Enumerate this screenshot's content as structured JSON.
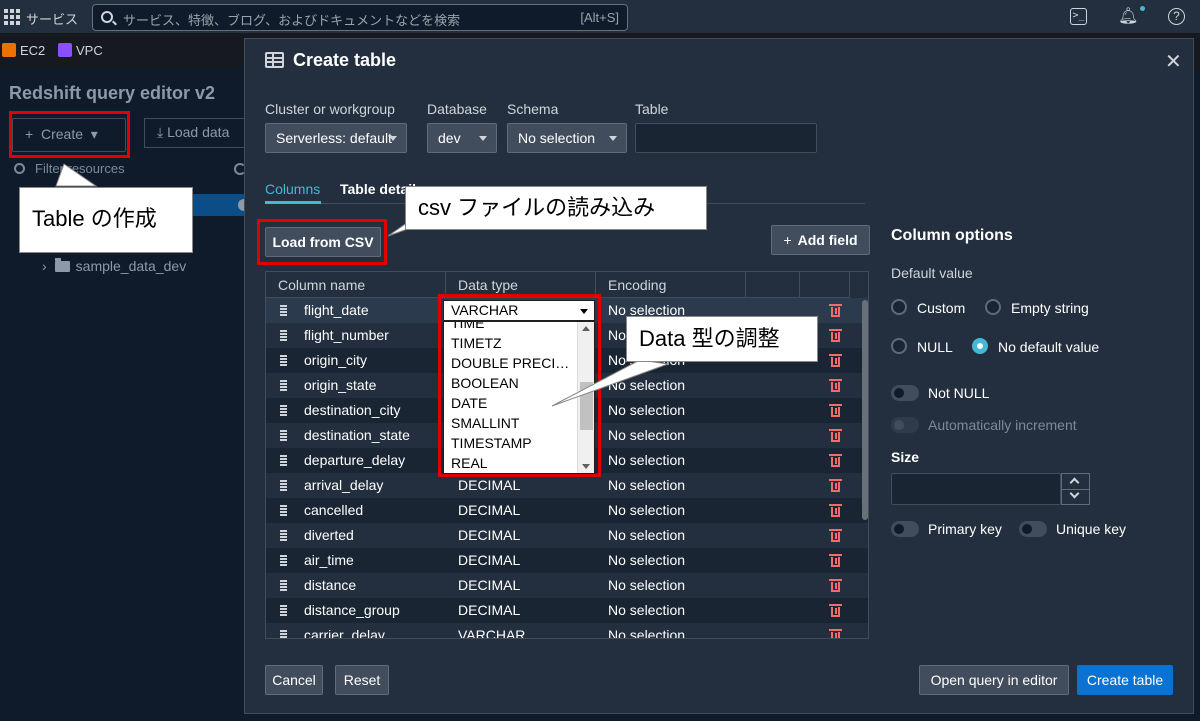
{
  "topnav": {
    "services_label": "サービス",
    "search_placeholder": "サービス、特徴、ブログ、およびドキュメントなどを検索",
    "search_shortcut": "[Alt+S]"
  },
  "favorites": [
    {
      "label": "EC2",
      "color": "#ed7100"
    },
    {
      "label": "VPC",
      "color": "#8c4fff"
    }
  ],
  "left_panel": {
    "title": "Redshift query editor v2",
    "create_label": "Create",
    "load_label": "Load data",
    "filter_placeholder": "Filter resources",
    "tree_item": "sample_data_dev"
  },
  "modal": {
    "title": "Create table",
    "labels": {
      "cluster": "Cluster or workgroup",
      "database": "Database",
      "schema": "Schema",
      "table": "Table"
    },
    "values": {
      "cluster": "Serverless: default",
      "database": "dev",
      "schema": "No selection",
      "table": ""
    },
    "tabs": [
      "Columns",
      "Table details"
    ],
    "load_csv_label": "Load from CSV",
    "add_field_label": "Add field",
    "table_headers": [
      "Column name",
      "Data type",
      "Encoding"
    ],
    "rows": [
      {
        "name": "flight_date",
        "type": "VARCHAR",
        "encoding": "No selection"
      },
      {
        "name": "flight_number",
        "type": "",
        "encoding": "No selection"
      },
      {
        "name": "origin_city",
        "type": "",
        "encoding": "No selection"
      },
      {
        "name": "origin_state",
        "type": "",
        "encoding": "No selection"
      },
      {
        "name": "destination_city",
        "type": "",
        "encoding": "No selection"
      },
      {
        "name": "destination_state",
        "type": "",
        "encoding": "No selection"
      },
      {
        "name": "departure_delay",
        "type": "",
        "encoding": "No selection"
      },
      {
        "name": "arrival_delay",
        "type": "DECIMAL",
        "encoding": "No selection"
      },
      {
        "name": "cancelled",
        "type": "DECIMAL",
        "encoding": "No selection"
      },
      {
        "name": "diverted",
        "type": "DECIMAL",
        "encoding": "No selection"
      },
      {
        "name": "air_time",
        "type": "DECIMAL",
        "encoding": "No selection"
      },
      {
        "name": "distance",
        "type": "DECIMAL",
        "encoding": "No selection"
      },
      {
        "name": "distance_group",
        "type": "DECIMAL",
        "encoding": "No selection"
      },
      {
        "name": "carrier_delay",
        "type": "VARCHAR",
        "encoding": "No selection"
      }
    ],
    "datatype_dropdown": {
      "selected": "VARCHAR",
      "options": [
        "TIME",
        "TIMETZ",
        "DOUBLE PRECI…",
        "BOOLEAN",
        "DATE",
        "SMALLINT",
        "TIMESTAMP",
        "REAL"
      ]
    },
    "column_options": {
      "title": "Column options",
      "default_value_label": "Default value",
      "radio_custom": "Custom",
      "radio_empty": "Empty string",
      "radio_null": "NULL",
      "radio_no_default": "No default value",
      "not_null": "Not NULL",
      "auto_increment": "Automatically increment",
      "size_label": "Size",
      "primary_key": "Primary key",
      "unique_key": "Unique key"
    },
    "footer": {
      "cancel": "Cancel",
      "reset": "Reset",
      "open_query": "Open query in editor",
      "create_table": "Create table"
    }
  },
  "annotations": {
    "create_callout": "Table の作成",
    "csv_callout": "csv ファイルの読み込み",
    "datatype_callout": "Data 型の調整"
  }
}
